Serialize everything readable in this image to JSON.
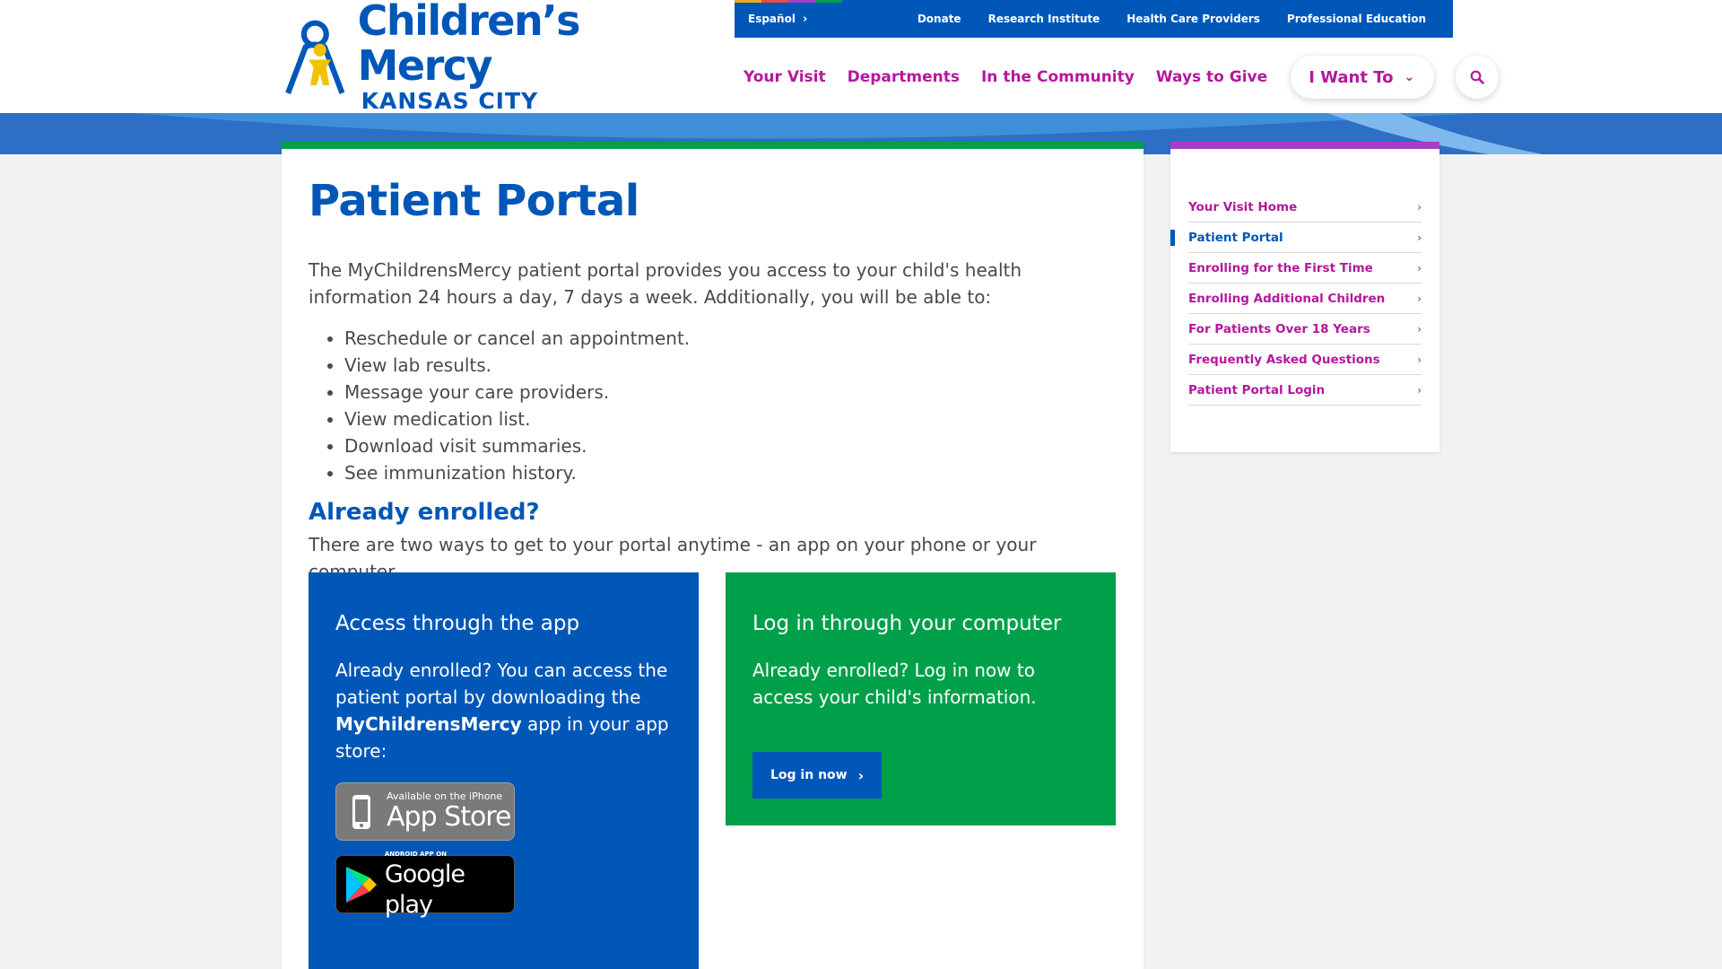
{
  "logo": {
    "line1": "Children’s Mercy",
    "line2": "KANSAS CITY"
  },
  "utility": {
    "language": "Español",
    "links": [
      "Donate",
      "Research Institute",
      "Health Care Providers",
      "Professional Education"
    ],
    "stripe_colors": [
      "#f5a623",
      "#e84c3d",
      "#a43fc6",
      "#00a04a"
    ]
  },
  "nav": {
    "items": [
      "Your Visit",
      "Departments",
      "In the Community",
      "Ways to Give"
    ],
    "i_want_to": "I Want To"
  },
  "main": {
    "title": "Patient Portal",
    "intro": "The MyChildrensMercy patient portal provides you access to your child's health information 24 hours a day, 7 days a week. Additionally, you will be able to:",
    "benefits": [
      "Reschedule or cancel an appointment.",
      "View lab results.",
      "Message your care providers.",
      "View medication list.",
      "Download visit summaries.",
      "See immunization history."
    ],
    "subhead": "Already enrolled?",
    "subtext": "There are two ways to get to your portal anytime - an app on your phone or your computer."
  },
  "app_panel": {
    "heading": "Access through the app",
    "text_before": "Already enrolled? You can access the patient portal by downloading the ",
    "app_name": "MyChildrensMercy",
    "text_after": " app in your app store:",
    "apple_small": "Available on the iPhone",
    "apple_big": "App Store",
    "google_small": "ANDROID APP ON",
    "google_big": "Google play"
  },
  "computer_panel": {
    "heading": "Log in through your computer",
    "text": "Already enrolled? Log in now to access your child's information.",
    "button": "Log in now"
  },
  "sidebar": {
    "items": [
      {
        "label": "Your Visit Home",
        "active": false
      },
      {
        "label": "Patient Portal",
        "active": true
      },
      {
        "label": "Enrolling for the First Time",
        "active": false
      },
      {
        "label": "Enrolling Additional Children",
        "active": false
      },
      {
        "label": "For Patients Over 18 Years",
        "active": false
      },
      {
        "label": "Frequently Asked Questions",
        "active": false
      },
      {
        "label": "Patient Portal Login",
        "active": false
      }
    ]
  },
  "colors": {
    "brand_blue": "#0057b8",
    "brand_green": "#00a04a",
    "brand_magenta": "#b5179e",
    "sidebar_accent": "#a43fc6"
  },
  "icons": [
    "logo-mark-icon",
    "chevron-right-icon",
    "chevron-down-icon",
    "search-icon",
    "phone-icon",
    "play-triangle-icon"
  ]
}
